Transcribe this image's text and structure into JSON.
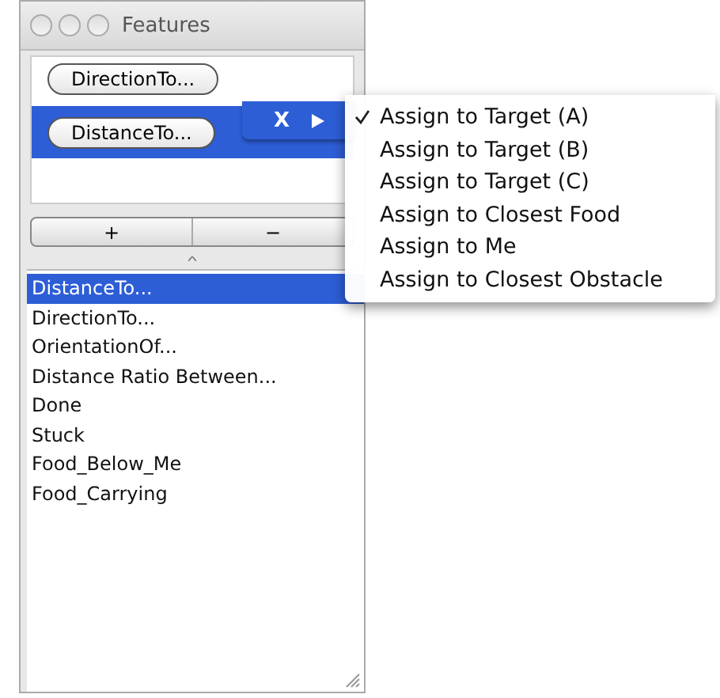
{
  "window": {
    "title": "Features"
  },
  "features": [
    {
      "label": "DirectionTo...",
      "selected": false
    },
    {
      "label": "DistanceTo...",
      "selected": true
    }
  ],
  "variable_popup": {
    "label": "X"
  },
  "buttons": [
    "+",
    "−"
  ],
  "list": [
    {
      "label": "DistanceTo...",
      "selected": true
    },
    {
      "label": "DirectionTo...",
      "selected": false
    },
    {
      "label": "OrientationOf...",
      "selected": false
    },
    {
      "label": "Distance Ratio Between...",
      "selected": false
    },
    {
      "label": "Done",
      "selected": false
    },
    {
      "label": "Stuck",
      "selected": false
    },
    {
      "label": "Food_Below_Me",
      "selected": false
    },
    {
      "label": "Food_Carrying",
      "selected": false
    }
  ],
  "menu": [
    {
      "label": "Assign to Target (A)",
      "checked": true
    },
    {
      "label": "Assign to Target (B)",
      "checked": false
    },
    {
      "label": "Assign to Target (C)",
      "checked": false
    },
    {
      "label": "Assign to Closest Food",
      "checked": false
    },
    {
      "label": "Assign to Me",
      "checked": false
    },
    {
      "label": "Assign to Closest Obstacle",
      "checked": false
    }
  ]
}
